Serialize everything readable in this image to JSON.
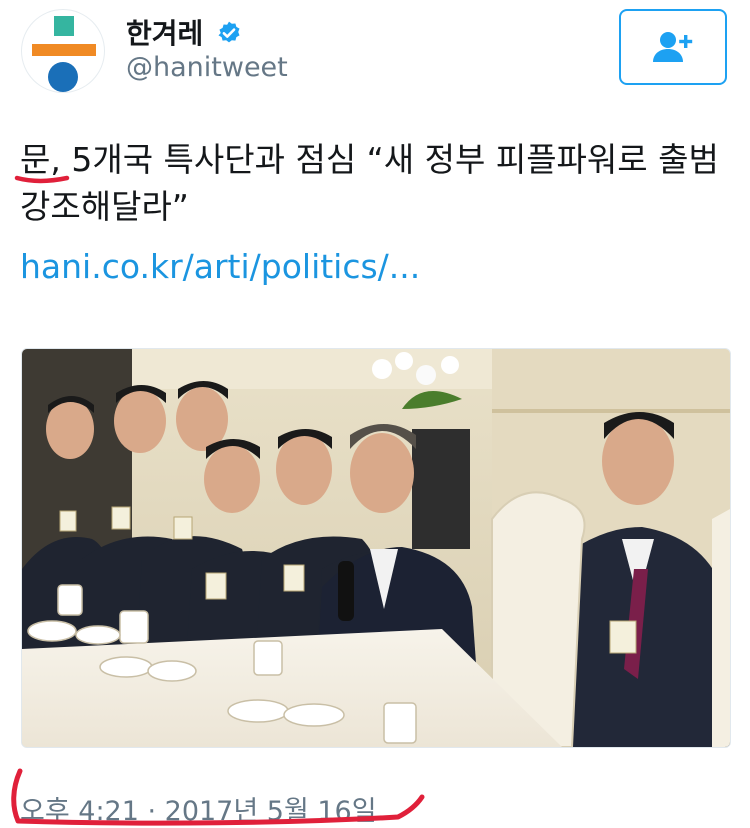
{
  "header": {
    "display_name": "한겨레",
    "handle": "@hanitweet",
    "verified": true,
    "follow_icon": "add-user-icon"
  },
  "tweet": {
    "text": "문, 5개국 특사단과 점심 “새 정부 피플파워로 출범 강조해달라”",
    "link_text": "hani.co.kr/arti/politics/...",
    "timestamp": "오후 4:21 · 2017년 5월 16일"
  },
  "colors": {
    "link": "#1b95e0",
    "verified_badge": "#1da1f2",
    "annotation": "#e0203a",
    "secondary_text": "#657786"
  }
}
